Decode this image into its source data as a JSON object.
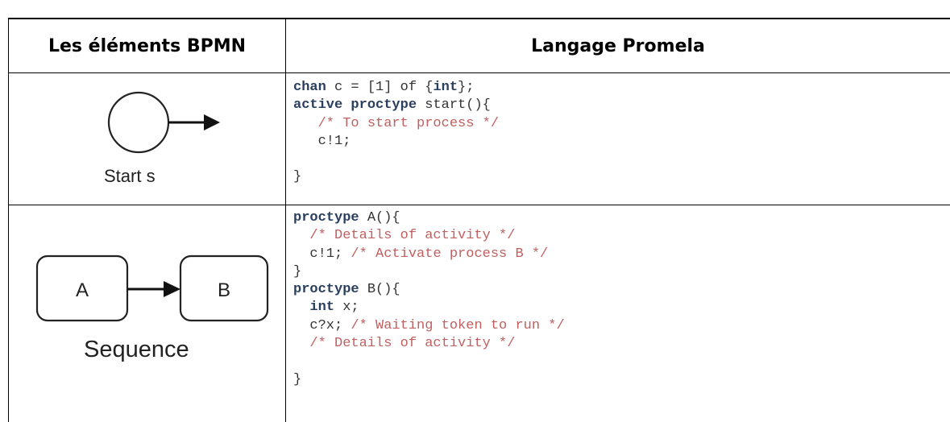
{
  "headers": {
    "left": "Les éléments BPMN",
    "right": "Langage Promela"
  },
  "rows": [
    {
      "caption": "Start s",
      "code": [
        [
          [
            "kw",
            "chan"
          ],
          [
            "t",
            " c = [1] of {"
          ],
          [
            "kw",
            "int"
          ],
          [
            "t",
            "};"
          ]
        ],
        [
          [
            "kw",
            "active proctype"
          ],
          [
            "t",
            " start(){"
          ]
        ],
        [
          [
            "t",
            "   "
          ],
          [
            "cm",
            "/* To start process */"
          ]
        ],
        [
          [
            "t",
            "   c!1;"
          ]
        ],
        [
          [
            "t",
            ""
          ]
        ],
        [
          [
            "t",
            "}"
          ]
        ]
      ]
    },
    {
      "caption": "Sequence",
      "box_a": "A",
      "box_b": "B",
      "code": [
        [
          [
            "kw",
            "proctype"
          ],
          [
            "t",
            " A(){"
          ]
        ],
        [
          [
            "t",
            "  "
          ],
          [
            "cm",
            "/* Details of activity */"
          ]
        ],
        [
          [
            "t",
            "  c!1; "
          ],
          [
            "cm",
            "/* Activate process B */"
          ]
        ],
        [
          [
            "t",
            "}"
          ]
        ],
        [
          [
            "kw",
            "proctype"
          ],
          [
            "t",
            " B(){"
          ]
        ],
        [
          [
            "t",
            "  "
          ],
          [
            "kw",
            "int"
          ],
          [
            "t",
            " x;"
          ]
        ],
        [
          [
            "t",
            "  c?x; "
          ],
          [
            "cm",
            "/* Waiting token to run */"
          ]
        ],
        [
          [
            "t",
            "  "
          ],
          [
            "cm",
            "/* Details of activity */"
          ]
        ],
        [
          [
            "t",
            ""
          ]
        ],
        [
          [
            "t",
            "}"
          ]
        ]
      ]
    }
  ]
}
